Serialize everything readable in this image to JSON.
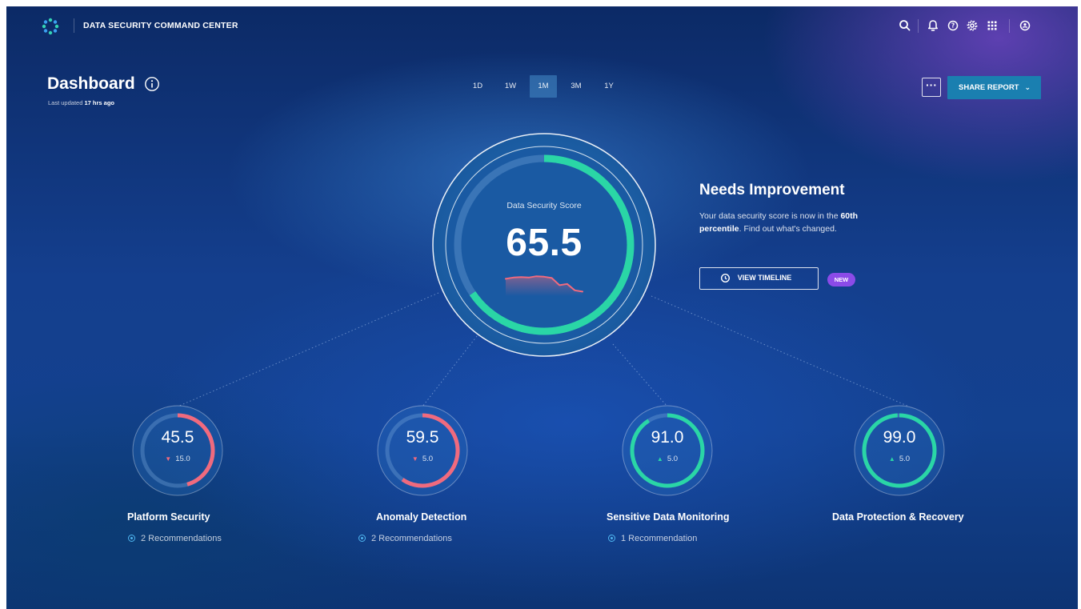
{
  "app": {
    "title": "DATA SECURITY COMMAND CENTER"
  },
  "icons": [
    "logo-icon",
    "search-icon",
    "bell-icon",
    "help-icon",
    "gear-icon",
    "apps-grid-icon",
    "account-icon",
    "info-icon",
    "more-icon",
    "chevron-down-icon",
    "clock-icon",
    "recommendation-icon"
  ],
  "header": {
    "title": "Dashboard",
    "last_updated_prefix": "Last updated",
    "last_updated_value": "17 hrs ago"
  },
  "time_ranges": [
    {
      "label": "1D",
      "active": false
    },
    {
      "label": "1W",
      "active": false
    },
    {
      "label": "1M",
      "active": true
    },
    {
      "label": "3M",
      "active": false
    },
    {
      "label": "1Y",
      "active": false
    }
  ],
  "actions": {
    "more_label": "···",
    "share_label": "SHARE REPORT"
  },
  "score": {
    "label": "Data Security Score",
    "value": "65.5",
    "progress": 0.655,
    "trend": [
      0.55,
      0.6,
      0.62,
      0.6,
      0.65,
      0.63,
      0.58,
      0.3,
      0.35,
      0.1,
      0.05
    ]
  },
  "status": {
    "title": "Needs Improvement",
    "desc_before": "Your data security score is now in the ",
    "desc_bold": "60th percentile",
    "desc_after": ". Find out what's changed.",
    "timeline_label": "VIEW TIMELINE",
    "badge": "NEW"
  },
  "categories": [
    {
      "name": "Platform Security",
      "value": "45.5",
      "progress": 0.455,
      "delta": "15.0",
      "direction": "down",
      "recommendations": "2 Recommendations"
    },
    {
      "name": "Anomaly Detection",
      "value": "59.5",
      "progress": 0.595,
      "delta": "5.0",
      "direction": "down",
      "recommendations": "2 Recommendations"
    },
    {
      "name": "Sensitive Data Monitoring",
      "value": "91.0",
      "progress": 0.91,
      "delta": "5.0",
      "direction": "up",
      "recommendations": "1 Recommendation"
    },
    {
      "name": "Data Protection & Recovery",
      "value": "99.0",
      "progress": 0.99,
      "delta": "5.0",
      "direction": "up",
      "recommendations": ""
    }
  ],
  "colors": {
    "good": "#2ad6a6",
    "bad": "#f06a7e",
    "accent": "#1a7fb0",
    "badge": "#8b4be8"
  }
}
